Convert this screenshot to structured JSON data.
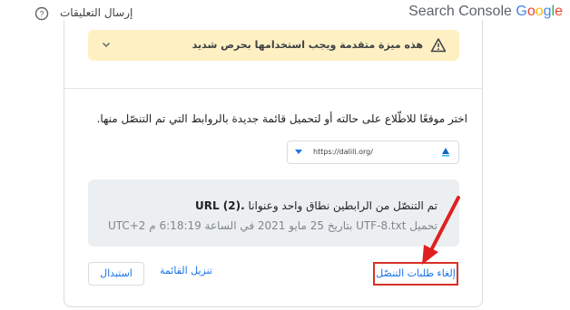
{
  "header": {
    "feedback_label": "إرسال التعليقات",
    "brand_product": "Search Console",
    "brand_letters": [
      "G",
      "o",
      "o",
      "g",
      "l",
      "e"
    ],
    "help_icon": "help-circle-icon"
  },
  "warning": {
    "text": "هذه ميزة متقدمة ويجب استخدامها بحرص شديد",
    "icon": "warning-triangle-icon",
    "expand_icon": "chevron-down-icon",
    "background": "#fef0c3"
  },
  "instruction": "اختر موقعًا للاطّلاع على حالته أو لتحميل قائمة جديدة بالروابط التي تم التنصّل منها.",
  "site_select": {
    "value": "https://dalili.org/",
    "favicon": "site-favicon-icon"
  },
  "info": {
    "line1_prefix": "تم التنصّل من الرابطين نطاق واحد وعنوانا ",
    "line1_bold": "URL (2).",
    "line2": "تحميل UTF-8.txt بتاريخ 25 مايو 2021 في الساعة 6:18:19 م UTC+2"
  },
  "actions": {
    "cancel_label": "إلغاء طلبات التنصّل",
    "download_label": "تنزيل القائمة",
    "replace_label": "استبدال"
  },
  "colors": {
    "accent": "#1a73e8",
    "highlight": "#d93025",
    "info_background": "#eceff1"
  }
}
